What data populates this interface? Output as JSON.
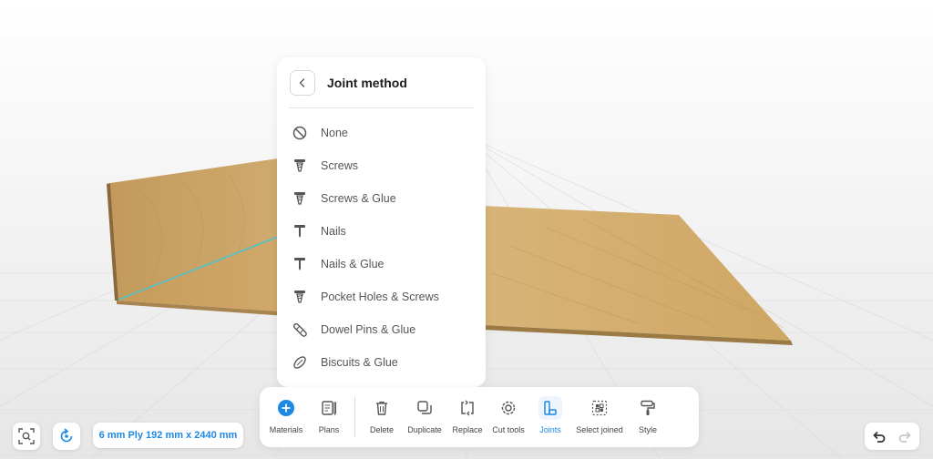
{
  "panel": {
    "title": "Joint method",
    "items": [
      {
        "label": "None",
        "icon": "none-icon"
      },
      {
        "label": "Screws",
        "icon": "screw-icon"
      },
      {
        "label": "Screws & Glue",
        "icon": "screw-glue-icon"
      },
      {
        "label": "Nails",
        "icon": "nail-icon"
      },
      {
        "label": "Nails & Glue",
        "icon": "nail-glue-icon"
      },
      {
        "label": "Pocket Holes & Screws",
        "icon": "pocket-screw-icon"
      },
      {
        "label": "Dowel Pins & Glue",
        "icon": "dowel-icon"
      },
      {
        "label": "Biscuits & Glue",
        "icon": "biscuit-icon"
      }
    ]
  },
  "toolbar": {
    "items": [
      {
        "label": "Materials",
        "icon": "plus-icon"
      },
      {
        "label": "Plans",
        "icon": "plans-icon"
      },
      {
        "label": "Delete",
        "icon": "trash-icon"
      },
      {
        "label": "Duplicate",
        "icon": "duplicate-icon"
      },
      {
        "label": "Replace",
        "icon": "replace-icon"
      },
      {
        "label": "Cut tools",
        "icon": "gear-icon"
      },
      {
        "label": "Joints",
        "icon": "joints-icon",
        "active": true
      },
      {
        "label": "Select joined",
        "icon": "select-joined-icon"
      },
      {
        "label": "Style",
        "icon": "paint-roller-icon"
      }
    ]
  },
  "material_badge": "6 mm Ply 192 mm x 2440 mm",
  "colors": {
    "accent": "#1e88e5",
    "wood": "#d2ac6e",
    "edge": "#4fc3c9"
  }
}
